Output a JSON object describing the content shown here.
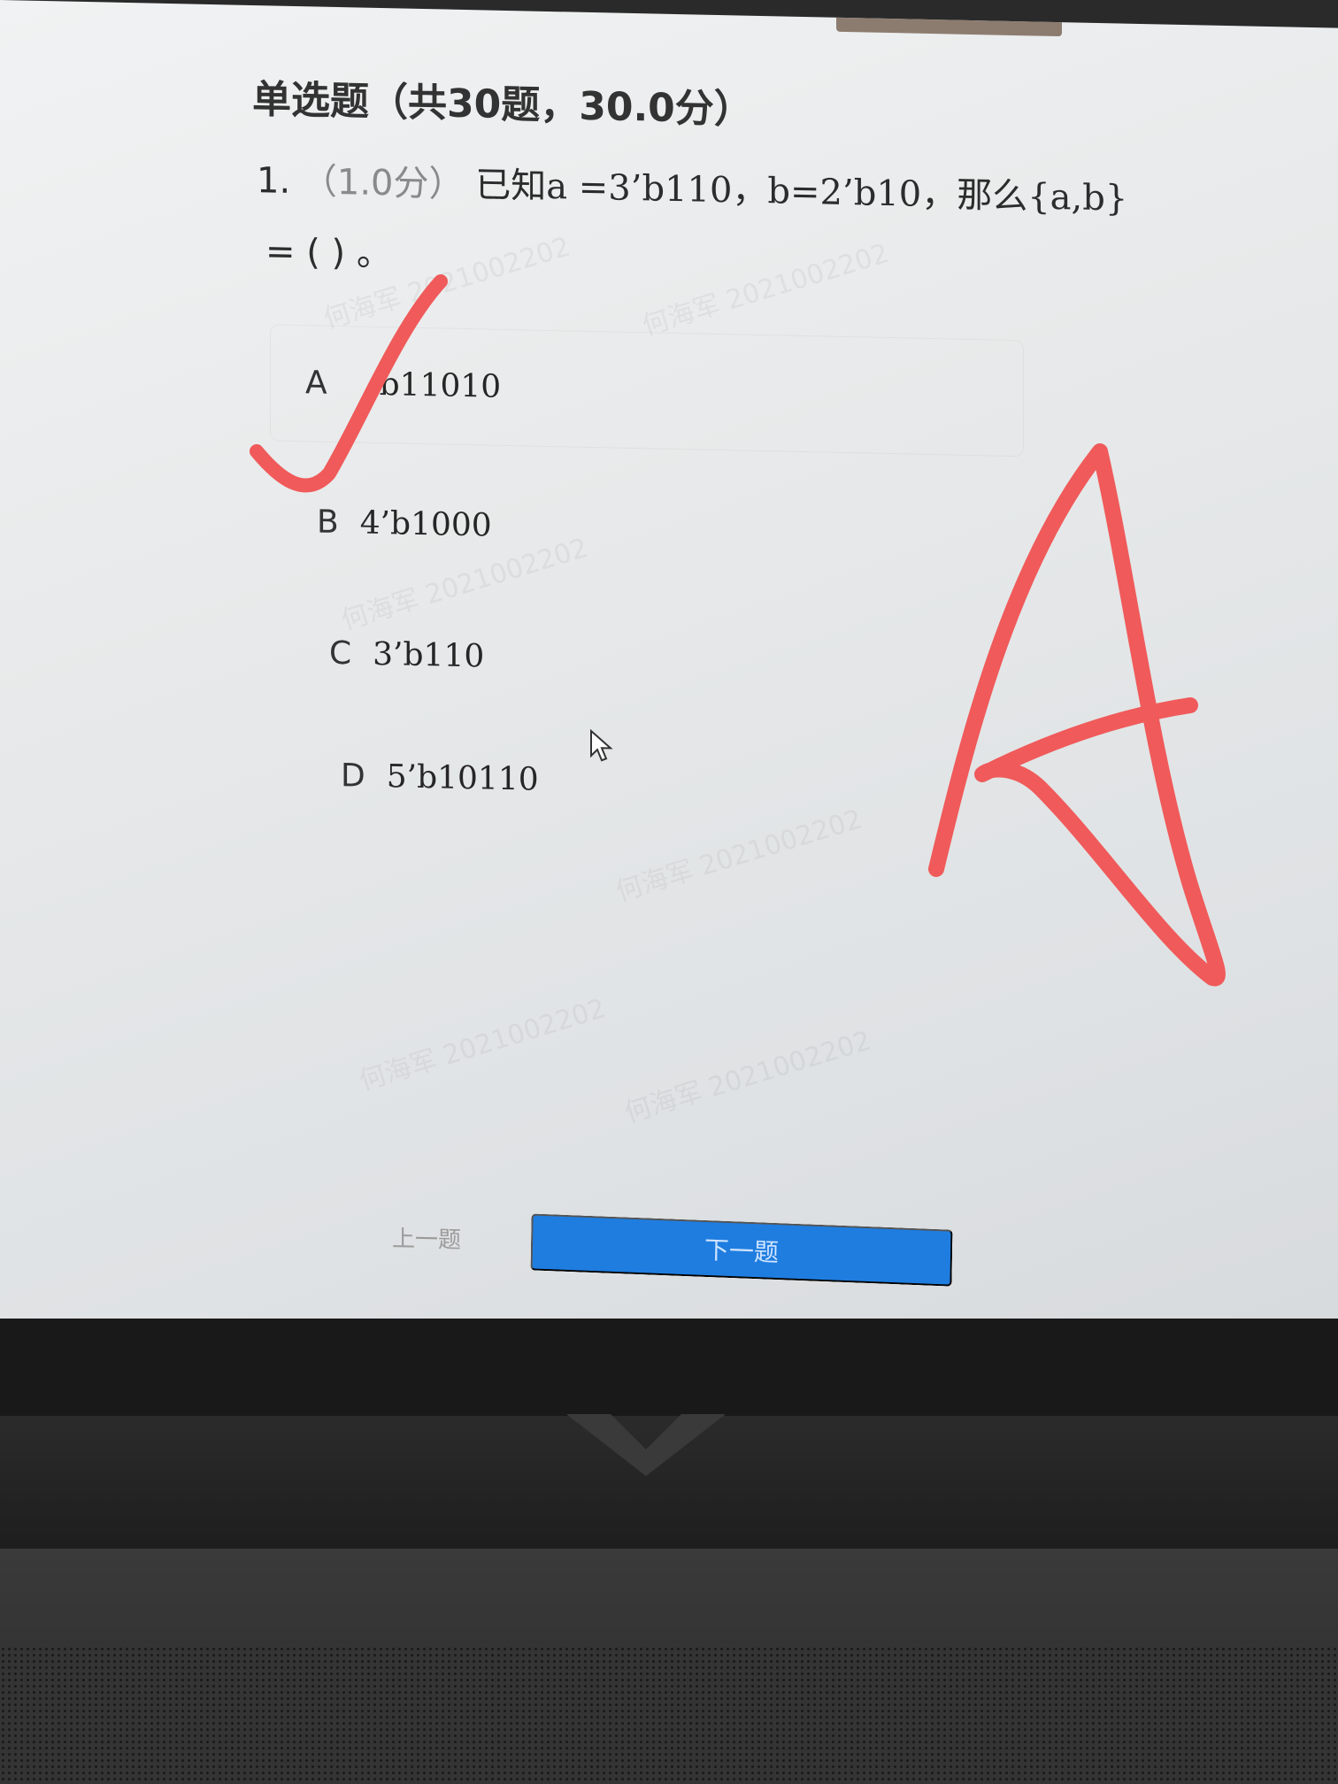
{
  "section_title": "单选题（共30题，30.0分）",
  "question": {
    "number": "1.",
    "score": "（1.0分）",
    "stem": "已知a =3’b110，b=2’b10，那么{a,b}",
    "stem_cont": "= (        ) 。"
  },
  "options": [
    {
      "letter": "A",
      "text": "b11010"
    },
    {
      "letter": "B",
      "text": "4’b1000"
    },
    {
      "letter": "C",
      "text": "3’b110"
    },
    {
      "letter": "D",
      "text": "5’b10110"
    }
  ],
  "watermarks": [
    "何海军 2021002202",
    "何海军 2021002202",
    "何海军 2021002202",
    "何海军 2021002202",
    "何海军 2021002202",
    "何海军 2021002202"
  ],
  "nav": {
    "prev_label": "上一题",
    "next_label": "下一题"
  },
  "annotation": {
    "color": "#f05a5a",
    "marks": [
      "check-mark-on-A",
      "handwritten-letter-A"
    ]
  },
  "colors": {
    "next_button": "#1f7de0",
    "screen_bg": "#e7e9ea"
  }
}
